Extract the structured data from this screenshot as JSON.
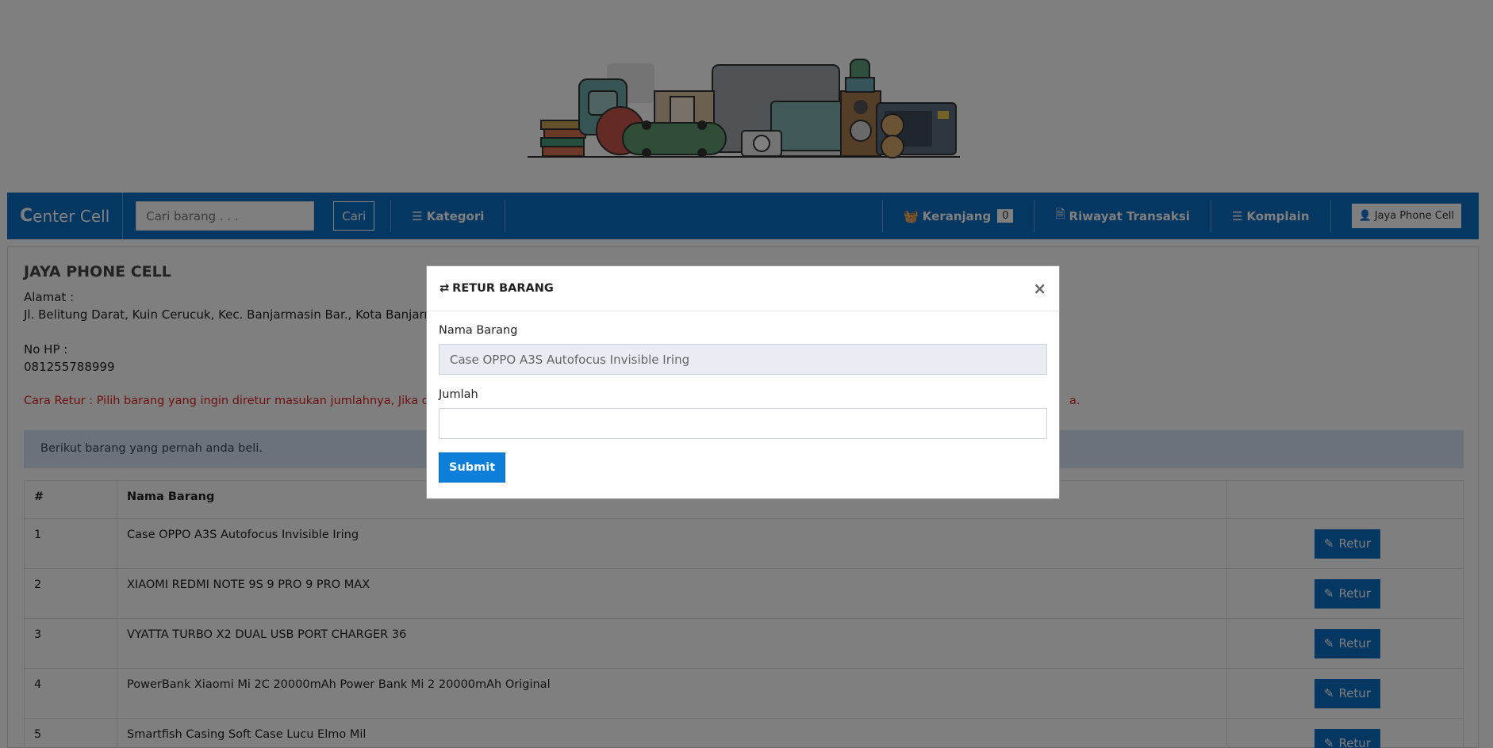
{
  "navbar": {
    "brand_c": "C",
    "brand_rest": "enter Cell",
    "search_placeholder": "Cari barang . . .",
    "search_button": "Cari",
    "kategori": "Kategori",
    "keranjang": "Keranjang",
    "keranjang_count": "0",
    "riwayat": "Riwayat Transaksi",
    "komplain": "Komplain",
    "user": "Jaya Phone Cell"
  },
  "store": {
    "name": "JAYA PHONE CELL",
    "address_label": "Alamat :",
    "address_value": "Jl. Belitung Darat, Kuin Cerucuk, Kec. Banjarmasin Bar., Kota Banjarmasin, K",
    "phone_label": "No HP :",
    "phone_value": "081255788999"
  },
  "instructions": "Cara Retur : Pilih barang yang ingin diretur masukan jumlahnya, Jika data su",
  "instructions_tail": "a.",
  "alert": "Berikut barang yang pernah anda beli.",
  "table": {
    "headers": [
      "#",
      "Nama Barang",
      ""
    ],
    "rows": [
      {
        "no": "1",
        "name": "Case OPPO A3S Autofocus Invisible Iring",
        "action": "Retur"
      },
      {
        "no": "2",
        "name": "XIAOMI REDMI NOTE 9S 9 PRO 9 PRO MAX",
        "action": "Retur"
      },
      {
        "no": "3",
        "name": "VYATTA TURBO X2 DUAL USB PORT CHARGER 36",
        "action": "Retur"
      },
      {
        "no": "4",
        "name": "PowerBank Xiaomi Mi 2C 20000mAh Power Bank Mi 2 20000mAh Original",
        "action": "Retur"
      },
      {
        "no": "5",
        "name": "Smartfish Casing Soft Case Lucu Elmo Mil",
        "action": "Retur"
      }
    ]
  },
  "modal": {
    "title": "RETUR BARANG",
    "close": "×",
    "nama_label": "Nama Barang",
    "nama_value": "Case OPPO A3S Autofocus Invisible Iring",
    "jumlah_label": "Jumlah",
    "jumlah_value": "",
    "submit": "Submit"
  },
  "icons": {
    "kategori": "list-icon",
    "keranjang": "basket-icon",
    "riwayat": "document-icon",
    "komplain": "list-icon",
    "user": "user-icon",
    "retur": "edit-icon",
    "modal_title": "exchange-icon"
  },
  "colors": {
    "primary": "#0b6fc7",
    "submit": "#0d7ed9",
    "warning_text": "#e01e1e",
    "alert_bg": "#d6e4f5"
  }
}
